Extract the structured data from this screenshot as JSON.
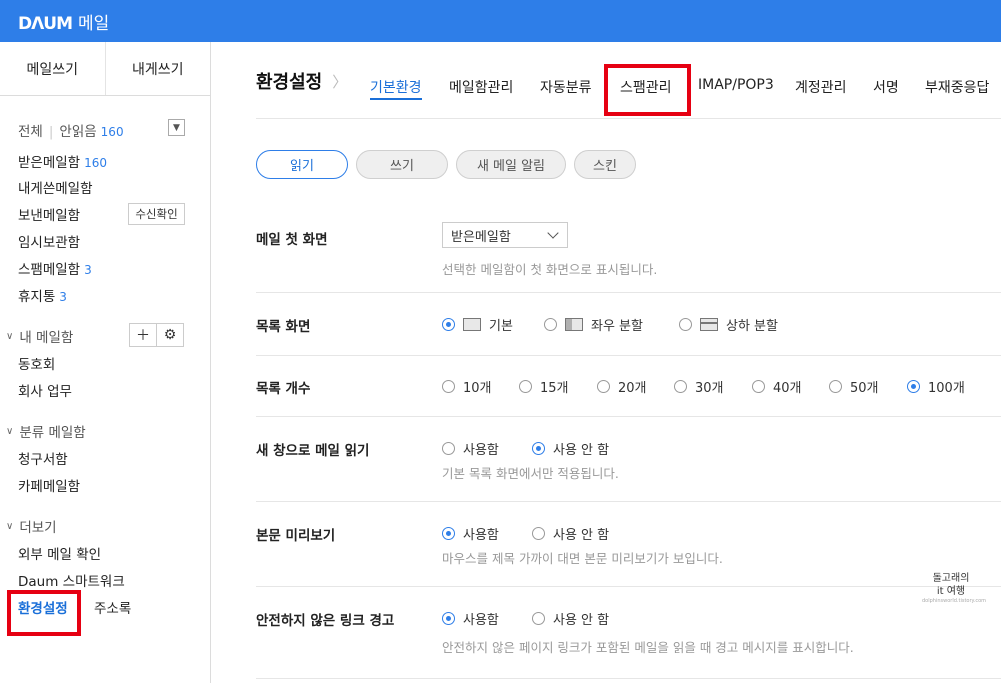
{
  "topbar": {
    "logo_mark": "DΛUM",
    "service": "메일"
  },
  "sidebar": {
    "compose": "메일쓰기",
    "compose_self": "내게쓰기",
    "all": "전체",
    "unread_label": "안읽음",
    "unread_count": "160",
    "inbox": "받은메일함",
    "inbox_count": "160",
    "to_me": "내게쓴메일함",
    "sent": "보낸메일함",
    "read_receipt": "수신확인",
    "drafts": "임시보관함",
    "spam": "스팸메일함",
    "spam_count": "3",
    "trash": "휴지통",
    "trash_count": "3",
    "my_mailbox": "내 메일함",
    "club": "동호회",
    "work": "회사 업무",
    "category_mailbox": "분류 메일함",
    "bills": "청구서함",
    "cafe": "카페메일함",
    "more": "더보기",
    "external": "외부 메일 확인",
    "smartwork": "Daum 스마트워크",
    "settings": "환경설정",
    "address_book": "주소록"
  },
  "header": {
    "title": "환경설정",
    "tabs": [
      "기본환경",
      "메일함관리",
      "자동분류",
      "스팸관리",
      "IMAP/POP3",
      "계정관리",
      "서명",
      "부재중응답"
    ]
  },
  "subtabs": [
    "읽기",
    "쓰기",
    "새 메일 알림",
    "스킨"
  ],
  "settings": {
    "first_screen": {
      "label": "메일 첫 화면",
      "value": "받은메일함",
      "help": "선택한 메일함이 첫 화면으로 표시됩니다."
    },
    "list_view": {
      "label": "목록 화면",
      "options": [
        "기본",
        "좌우 분할",
        "상하 분할"
      ],
      "selected": "기본"
    },
    "list_count": {
      "label": "목록 개수",
      "options": [
        "10개",
        "15개",
        "20개",
        "30개",
        "40개",
        "50개",
        "100개"
      ],
      "selected": "100개"
    },
    "new_window": {
      "label": "새 창으로 메일 읽기",
      "options": [
        "사용함",
        "사용 안 함"
      ],
      "selected": "사용 안 함",
      "help": "기본 목록 화면에서만 적용됩니다."
    },
    "preview": {
      "label": "본문 미리보기",
      "options": [
        "사용함",
        "사용 안 함"
      ],
      "selected": "사용함",
      "help": "마우스를 제목 가까이 대면 본문 미리보기가 보입니다."
    },
    "unsafe_link": {
      "label": "안전하지 않은 링크 경고",
      "options": [
        "사용함",
        "사용 안 함"
      ],
      "selected": "사용함",
      "help": "안전하지 않은 페이지 링크가 포함된 메일을 읽을 때 경고 메시지를 표시합니다."
    }
  },
  "watermark": {
    "line1": "돌고래의",
    "line2": "it 여행",
    "line3": "dolphinsworld.tistory.com"
  },
  "colors": {
    "topbar": "#2e7ee8",
    "accent": "#1a6fd8",
    "highlight_box": "#e60012"
  }
}
